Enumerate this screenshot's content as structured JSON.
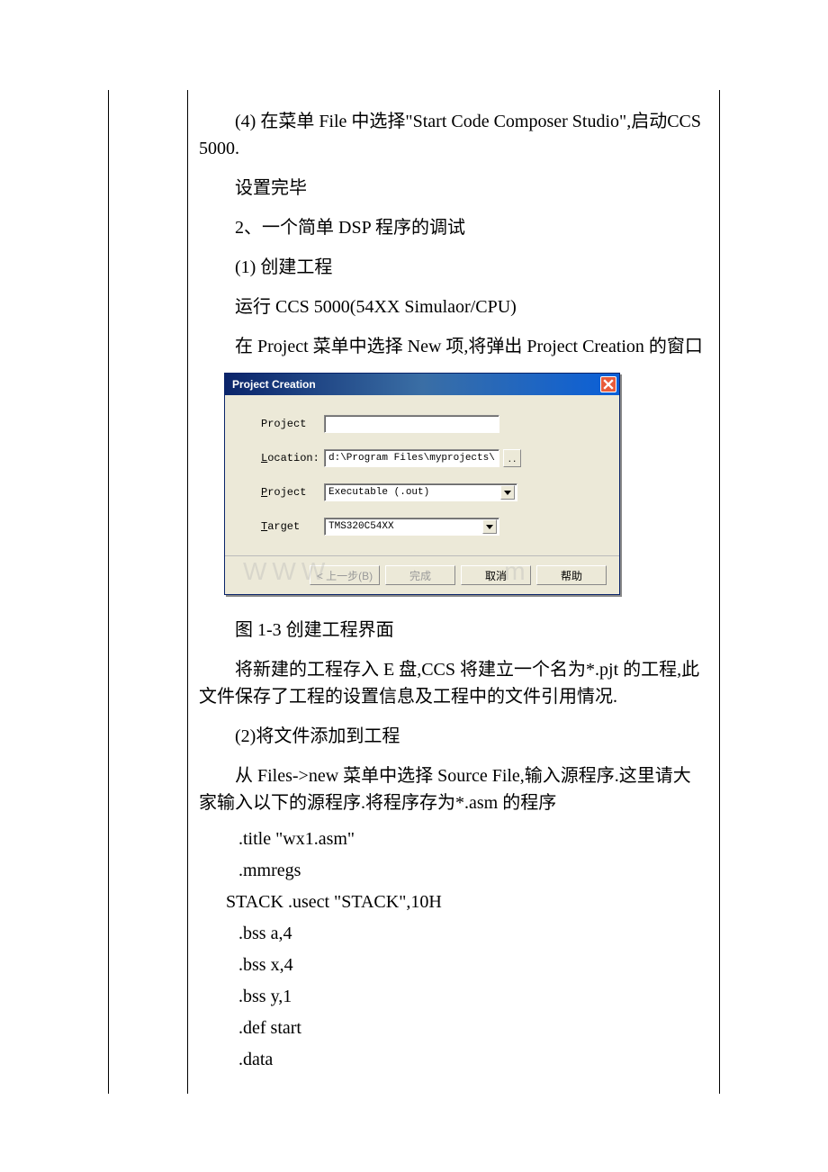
{
  "body": {
    "p1": "(4) 在菜单 File 中选择\"Start Code Composer Studio\",启动CCS 5000.",
    "p2": "设置完毕",
    "p3": "2、一个简单 DSP 程序的调试",
    "p4": "(1) 创建工程",
    "p5": "运行 CCS 5000(54XX Simulaor/CPU)",
    "p6": "在 Project 菜单中选择 New 项,将弹出 Project Creation 的窗口",
    "caption": "图 1-3 创建工程界面",
    "p7": "将新建的工程存入 E 盘,CCS 将建立一个名为*.pjt 的工程,此文件保存了工程的设置信息及工程中的文件引用情况.",
    "p8": "(2)将文件添加到工程",
    "p9": "从 Files->new 菜单中选择 Source File,输入源程序.这里请大家输入以下的源程序.将程序存为*.asm 的程序"
  },
  "code": {
    "l1": ".title \"wx1.asm\"",
    "l2": ".mmregs",
    "l3": "STACK .usect \"STACK\",10H",
    "l4": ".bss a,4",
    "l5": ".bss x,4",
    "l6": ".bss y,1",
    "l7": ".def start",
    "l8": ".data"
  },
  "dialog": {
    "title": "Project Creation",
    "labels": {
      "project": "Project",
      "location": "Location:",
      "project_type": "Project",
      "target": "Target"
    },
    "fields": {
      "project": "",
      "location": "d:\\Program Files\\myprojects\\",
      "project_type": "Executable (.out)",
      "target": "TMS320C54XX"
    },
    "buttons": {
      "back": "< 上一步(B)",
      "finish": "完成",
      "cancel": "取消",
      "help": "帮助"
    },
    "browse": ".."
  }
}
